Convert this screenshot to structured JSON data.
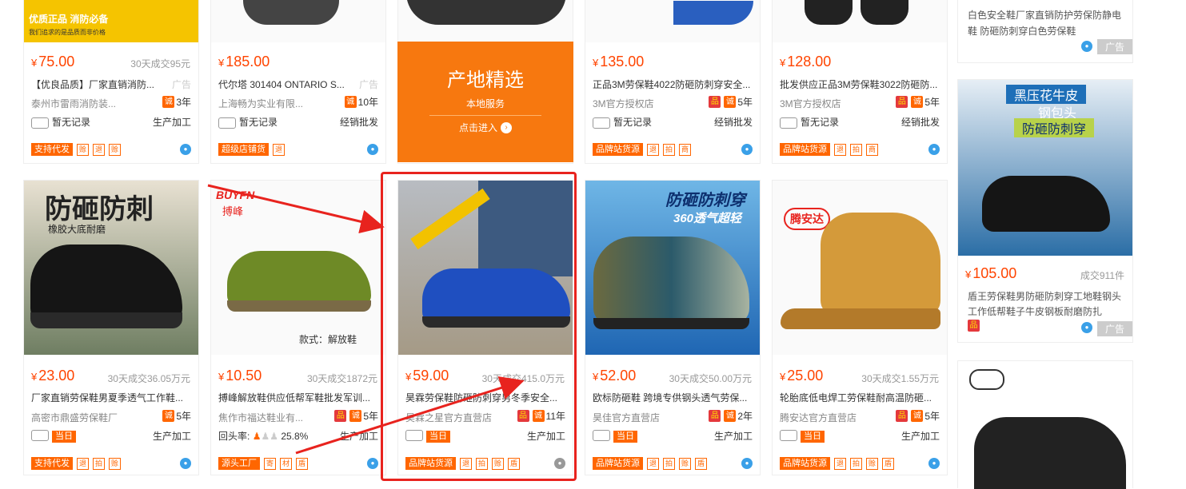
{
  "row1": [
    {
      "price": "75.00",
      "sales": "30天成交95元",
      "title": "【优良品质】厂家直销消防...",
      "ad": "广告",
      "shop": "泰州市雷雨消防装...",
      "years": "3年",
      "badges": [
        "诚"
      ],
      "row3_left": "暂无记录",
      "row3_right": "生产加工",
      "tags": [
        "支持代发"
      ],
      "minis": [
        "赊",
        "退",
        "赊"
      ],
      "banner": "优质正品 消防必备",
      "banner_sub": "我们追求的是品质而非价格"
    },
    {
      "price": "185.00",
      "sales": "",
      "title": "代尔塔 301404 ONTARIO S...",
      "ad": "广告",
      "shop": "上海畅为实业有限...",
      "years": "10年",
      "badges": [
        "诚"
      ],
      "row3_left": "暂无记录",
      "row3_right": "经销批发",
      "tags": [
        "超级店铺货"
      ],
      "minis": [
        "退"
      ]
    },
    {
      "price": "",
      "feature_title": "产地精选",
      "feature_sub": "本地服务",
      "feature_link": "点击进入"
    },
    {
      "price": "135.00",
      "sales": "",
      "title": "正品3M劳保鞋4022防砸防刺穿安全...",
      "shop": "3M官方授权店",
      "years": "5年",
      "badges": [
        "品",
        "诚"
      ],
      "row3_left": "暂无记录",
      "row3_right": "经销批发",
      "tags": [
        "品牌站货源"
      ],
      "minis": [
        "退",
        "拍",
        "商"
      ]
    },
    {
      "price": "128.00",
      "sales": "",
      "title": "批发供应正品3M劳保鞋3022防砸防...",
      "shop": "3M官方授权店",
      "years": "5年",
      "badges": [
        "品",
        "诚"
      ],
      "row3_left": "暂无记录",
      "row3_right": "经销批发",
      "tags": [
        "品牌站货源"
      ],
      "minis": [
        "退",
        "拍",
        "商"
      ]
    }
  ],
  "row2": [
    {
      "price": "23.00",
      "sales": "30天成交36.05万元",
      "title": "厂家直销劳保鞋男夏季透气工作鞋...",
      "shop": "高密市鼎盛劳保鞋厂",
      "years": "5年",
      "badges": [
        "诚"
      ],
      "row3_left": "当日",
      "row3_right": "生产加工",
      "tags": [
        "支持代发"
      ],
      "minis": [
        "退",
        "拍",
        "赊"
      ],
      "img_text": "防砸防刺",
      "img_sub": "橡胶大底耐磨"
    },
    {
      "price": "10.50",
      "sales": "30天成交1872元",
      "title": "搏峰解放鞋供应低帮军鞋批发军训...",
      "shop": "焦作市福达鞋业有...",
      "years": "5年",
      "badges": [
        "品",
        "诚"
      ],
      "row3_left": "回头率:",
      "rate": "25.8%",
      "row3_right": "生产加工",
      "tags": [
        "源头工厂"
      ],
      "minis": [
        "寄",
        "材",
        "盾"
      ],
      "img_text": "款式：解放鞋",
      "brand": "BUYFN",
      "brand_cn": "搏峰"
    },
    {
      "price": "59.00",
      "sales": "30天成交415.0万元",
      "title": "昊霖劳保鞋防砸防刺穿男冬季安全...",
      "shop": "昊霖之星官方直营店",
      "years": "11年",
      "badges": [
        "品",
        "诚"
      ],
      "row3_left": "当日",
      "row3_right": "生产加工",
      "tags": [
        "品牌站货源"
      ],
      "minis": [
        "退",
        "拍",
        "赊",
        "盾"
      ]
    },
    {
      "price": "52.00",
      "sales": "30天成交50.00万元",
      "title": "欧标防砸鞋 跨境专供钢头透气劳保...",
      "shop": "昊佳官方直营店",
      "years": "2年",
      "badges": [
        "品",
        "诚"
      ],
      "row3_left": "当日",
      "row3_right": "生产加工",
      "tags": [
        "品牌站货源"
      ],
      "minis": [
        "退",
        "拍",
        "赊",
        "盾"
      ],
      "img_text": "防砸防刺穿",
      "img_sub": "360透气超轻"
    },
    {
      "price": "25.00",
      "sales": "30天成交1.55万元",
      "title": "轮胎底低电焊工劳保鞋耐高温防砸...",
      "shop": "腾安达官方直营店",
      "years": "5年",
      "badges": [
        "品",
        "诚"
      ],
      "row3_left": "当日",
      "row3_right": "生产加工",
      "tags": [
        "品牌站货源"
      ],
      "minis": [
        "退",
        "拍",
        "赊",
        "盾"
      ],
      "brand": "腾安达"
    }
  ],
  "side": {
    "top_text1": "白色安全鞋厂家直销防护劳保防静电",
    "top_text2": "鞋 防砸防刺穿白色劳保鞋",
    "top_ad": "广告",
    "mid_banner1": "黑压花牛皮",
    "mid_banner2": "钢包头",
    "mid_banner3": "防砸防刺穿",
    "mid_price": "105.00",
    "mid_sales": "成交911件",
    "mid_title1": "盾王劳保鞋男防砸防刺穿工地鞋钢头",
    "mid_title2": "工作低帮鞋子牛皮钢板耐磨防扎",
    "mid_ad": "广告"
  },
  "currency": "¥"
}
